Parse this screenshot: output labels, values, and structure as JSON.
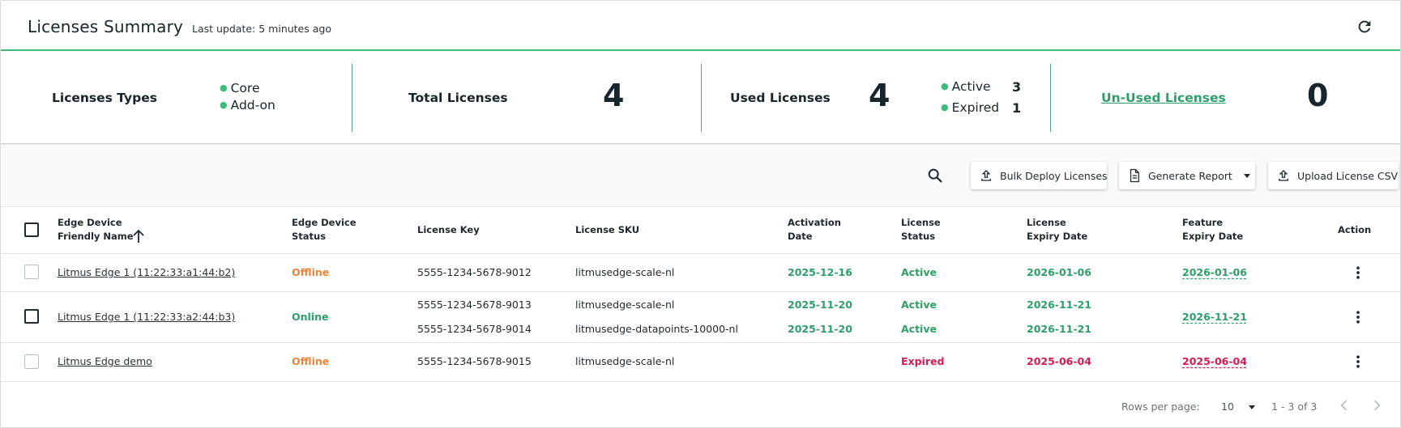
{
  "header": {
    "title": "Licenses Summary",
    "last_update": "Last update: 5 minutes ago"
  },
  "summary": {
    "types_label": "Licenses Types",
    "types": [
      "Core",
      "Add-on"
    ],
    "total_label": "Total Licenses",
    "total_value": "4",
    "used_label": "Used Licenses",
    "used_value": "4",
    "used_breakdown": [
      {
        "label": "Active",
        "count": "3"
      },
      {
        "label": "Expired",
        "count": "1"
      }
    ],
    "unused_label": "Un-Used Licenses",
    "unused_value": "0"
  },
  "toolbar": {
    "bulk_deploy": "Bulk Deploy Licenses",
    "generate_report": "Generate Report",
    "upload_csv": "Upload License CSV"
  },
  "table": {
    "headers": {
      "device_name": [
        "Edge Device",
        "Friendly Name"
      ],
      "device_status": [
        "Edge Device",
        "Status"
      ],
      "license_key": "License Key",
      "license_sku": "License SKU",
      "activation_date": [
        "Activation",
        "Date"
      ],
      "license_status": [
        "License",
        "Status"
      ],
      "license_expiry": [
        "License",
        "Expiry Date"
      ],
      "feature_expiry": [
        "Feature",
        "Expiry Date"
      ],
      "action": "Action"
    },
    "rows": [
      {
        "device": "Litmus Edge 1 (11:22:33:a1:44:b2)",
        "status": "Offline",
        "licenses": [
          {
            "key": "5555-1234-5678-9012",
            "sku": "litmusedge-scale-nl",
            "activation": "2025-12-16",
            "status": "Active",
            "expiry": "2026-01-06"
          }
        ],
        "feature_expiry": "2026-01-06"
      },
      {
        "device": "Litmus Edge 1 (11:22:33:a2:44:b3)",
        "status": "Online",
        "licenses": [
          {
            "key": "5555-1234-5678-9013",
            "sku": "litmusedge-scale-nl",
            "activation": "2025-11-20",
            "status": "Active",
            "expiry": "2026-11-21"
          },
          {
            "key": "5555-1234-5678-9014",
            "sku": "litmusedge-datapoints-10000-nl",
            "activation": "2025-11-20",
            "status": "Active",
            "expiry": "2026-11-21"
          }
        ],
        "feature_expiry": "2026-11-21"
      },
      {
        "device": "Litmus Edge demo",
        "status": "Offline",
        "licenses": [
          {
            "key": "5555-1234-5678-9015",
            "sku": "litmusedge-scale-nl",
            "activation": "",
            "status": "Expired",
            "expiry": "2025-06-04"
          }
        ],
        "feature_expiry": "2025-06-04"
      }
    ]
  },
  "footer": {
    "rows_per_page_label": "Rows per page:",
    "rows_per_page_value": "10",
    "range": "1 - 3 of 3"
  },
  "colors": {
    "accent": "#3dbb7a",
    "green_text": "#2f9e6b",
    "offline": "#e8843a",
    "expired": "#d81b52",
    "dark": "#17262b"
  },
  "icons": [
    "refresh-icon",
    "search-icon",
    "upload-icon",
    "document-icon",
    "caret-down-icon",
    "sort-arrow-up-icon",
    "more-vert-icon",
    "chevron-left-icon",
    "chevron-right-icon"
  ]
}
